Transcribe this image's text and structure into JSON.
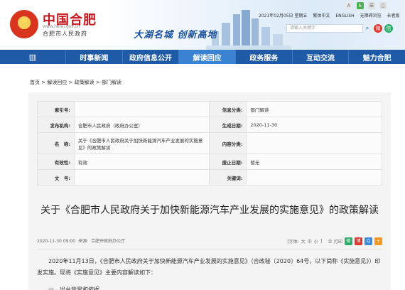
{
  "header": {
    "title": "中国合肥",
    "url": "www.hefei.gov.cn",
    "subtitle": "合肥市人民政府",
    "slogan": "大湖名城  创新高地",
    "date": "2021年02月05日 星期五",
    "links": [
      "繁体中文",
      "ENGLISH",
      "无障碍浏览",
      "长者版"
    ],
    "search_placeholder": "请输入关键字",
    "colors": {
      "brand_red": "#c8161d",
      "nav_blue": "#1f5aa6",
      "nav_active": "#3a82d2"
    }
  },
  "nav": {
    "items": [
      "时事新闻",
      "政府信息公开",
      "解读回应",
      "政务服务",
      "互动交流",
      "魅力合肥"
    ],
    "active_index": 2
  },
  "breadcrumb": [
    "首页",
    "解读回应",
    "政策解读",
    "部门解读"
  ],
  "meta": {
    "labels": {
      "index_no": "索引号:",
      "category": "信息分类:",
      "publisher": "发布机构:",
      "gen_date": "生成日期:",
      "name": "名　称:",
      "topic": "内容分类:",
      "validity": "有效性:",
      "abolish": "废止日期:",
      "doc_no": "文　号:",
      "keywords": "关键词:"
    },
    "values": {
      "index_no": "",
      "category": "部门解读",
      "publisher": "合肥市人民政府（政府办公室）",
      "gen_date": "2020-11-30",
      "name": "关于《合肥市人民政府关于加快新能源汽车产业发展的实施意见》的政策解读",
      "topic": "",
      "validity": "有效",
      "abolish": "暂无",
      "doc_no": "",
      "keywords": ""
    }
  },
  "article": {
    "title": "关于《合肥市人民政府关于加快新能源汽车产业发展的实施意见》的政策解读",
    "datetime": "2020-11-30 09:00",
    "source_label": "来源:",
    "source": "合肥市政府办公厅",
    "font_label": "[字体:",
    "font_sizes": [
      "大",
      "中",
      "小"
    ],
    "font_close": "]",
    "print_label": "打印",
    "body": "2020年11月13日，《合肥市人民政府关于加快新能源汽车产业发展的实施意见》（合政秘〔2020〕64号，以下简称《实施意见》）印发实施。现将《实施意见》主要内容解读如下：",
    "next_heading": "一、出台背景和依据"
  }
}
